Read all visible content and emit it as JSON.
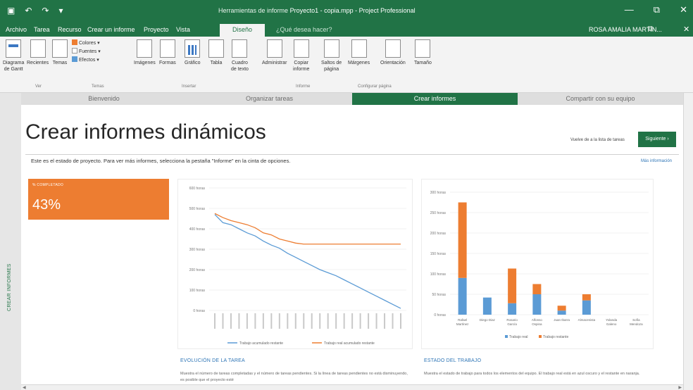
{
  "app": {
    "qat_icons": [
      "save-icon",
      "undo-icon",
      "redo-icon",
      "customize-icon"
    ],
    "title_prefix": "Herramientas de informe",
    "title_main": "Proyecto1 - copia.mpp - Project Professional",
    "window_controls": [
      "—",
      "⧉",
      "✕"
    ]
  },
  "tabs": {
    "items": [
      "Archivo",
      "Tarea",
      "Recurso",
      "Crear un informe",
      "Proyecto",
      "Vista"
    ],
    "active": "Diseño",
    "tell_me": "¿Qué desea hacer?",
    "user": "ROSA AMALIA MARTIN...",
    "ribbon_display": "⧉",
    "close": "✕"
  },
  "ribbon": {
    "buttons": [
      {
        "label": "Diagrama\nde Gantt",
        "icon": "gantt-icon"
      },
      {
        "label": "Recientes",
        "icon": "recent-icon"
      },
      {
        "label": "Temas",
        "icon": "themes-icon"
      },
      {
        "label": "Imágenes",
        "icon": "images-icon"
      },
      {
        "label": "Formas",
        "icon": "shapes-icon"
      },
      {
        "label": "Gráfico",
        "icon": "chart-icon"
      },
      {
        "label": "Tabla",
        "icon": "table-icon"
      },
      {
        "label": "Cuadro\nde texto",
        "icon": "textbox-icon"
      },
      {
        "label": "Administrar",
        "icon": "manage-icon"
      },
      {
        "label": "Copiar\ninforme",
        "icon": "copy-report-icon"
      },
      {
        "label": "Saltos de\npágina",
        "icon": "page-breaks-icon"
      },
      {
        "label": "Márgenes",
        "icon": "margins-icon"
      },
      {
        "label": "Orientación",
        "icon": "orientation-icon"
      },
      {
        "label": "Tamaño",
        "icon": "size-icon"
      }
    ],
    "theme_options": [
      "Colores",
      "Fuentes",
      "Efectos"
    ],
    "groups": [
      "Ver",
      "Temas",
      "Insertar",
      "Informe",
      "Configurar página"
    ]
  },
  "leftbar": {
    "label": "CREAR INFORMES"
  },
  "nav": {
    "items": [
      "Bienvenido",
      "Organizar tareas",
      "Crear informes",
      "Compartir con su equipo"
    ],
    "active_index": 2
  },
  "main": {
    "heading": "Crear informes dinámicos",
    "mini_link": "Vuelve de a la lista de tareas",
    "next_label": "Siguiente ›",
    "intro": "Este es el estado de proyecto.  Para ver más informes, selecciona la pestaña \"Informe\" en la cinta de opciones.",
    "more_link": "Más información",
    "tile_label": "% COMPLETADO",
    "tile_value": "43%",
    "section1_title": "EVOLUCIÓN DE LA TAREA",
    "section1_text": "Muestra el número de tareas completadas y el número de tareas pendientes. Si la línea de tareas pendientes no está disminuyendo, es posible que el proyecto esté",
    "section2_title": "ESTADO DEL TRABAJO",
    "section2_text": "Muestra el estado de trabajo para todos los elementos del equipo. El trabajo real está en azul oscuro y el restante en naranja.",
    "accent": "#217346",
    "tile_color": "#ed7d31"
  },
  "chart_data": [
    {
      "type": "line",
      "title": "",
      "ylabel": "",
      "xlabel": "",
      "y_ticks": [
        "0 horas",
        "100 horas",
        "200 horas",
        "300 horas",
        "400 horas",
        "500 horas",
        "600 horas"
      ],
      "ylim": [
        0,
        600
      ],
      "x_count": 24,
      "series": [
        {
          "name": "Trabajo acumulado restante",
          "color": "#5b9bd5",
          "values": [
            470,
            430,
            420,
            400,
            380,
            365,
            340,
            320,
            305,
            280,
            260,
            240,
            220,
            200,
            185,
            170,
            150,
            130,
            110,
            90,
            70,
            50,
            30,
            10
          ]
        },
        {
          "name": "Trabajo real acumulado restante",
          "color": "#ed7d31",
          "values": [
            475,
            455,
            440,
            430,
            420,
            405,
            380,
            370,
            350,
            340,
            330,
            325,
            325,
            325,
            325,
            325,
            325,
            325,
            325,
            325,
            325,
            325,
            325,
            325
          ]
        }
      ],
      "legend": "bottom"
    },
    {
      "type": "bar",
      "stacked": true,
      "title": "",
      "y_ticks": [
        "0 horas",
        "50 horas",
        "100 horas",
        "150 horas",
        "200 horas",
        "250 horas",
        "300 horas"
      ],
      "ylim": [
        0,
        300
      ],
      "categories": [
        "Rafael\nMartínez",
        "Diego Diaz",
        "Rosario\nGarcía",
        "Alfonso\nOspina",
        "Juan Ibarra",
        "Almacenista",
        "Yolanda\nGaleno",
        "Sofía\nMendoza"
      ],
      "series": [
        {
          "name": "Trabajo real",
          "color": "#5b9bd5",
          "values": [
            90,
            42,
            28,
            50,
            10,
            35,
            0,
            0
          ]
        },
        {
          "name": "Trabajo restante",
          "color": "#ed7d31",
          "values": [
            185,
            0,
            85,
            25,
            12,
            15,
            0,
            0
          ]
        }
      ],
      "legend": "bottom"
    }
  ]
}
